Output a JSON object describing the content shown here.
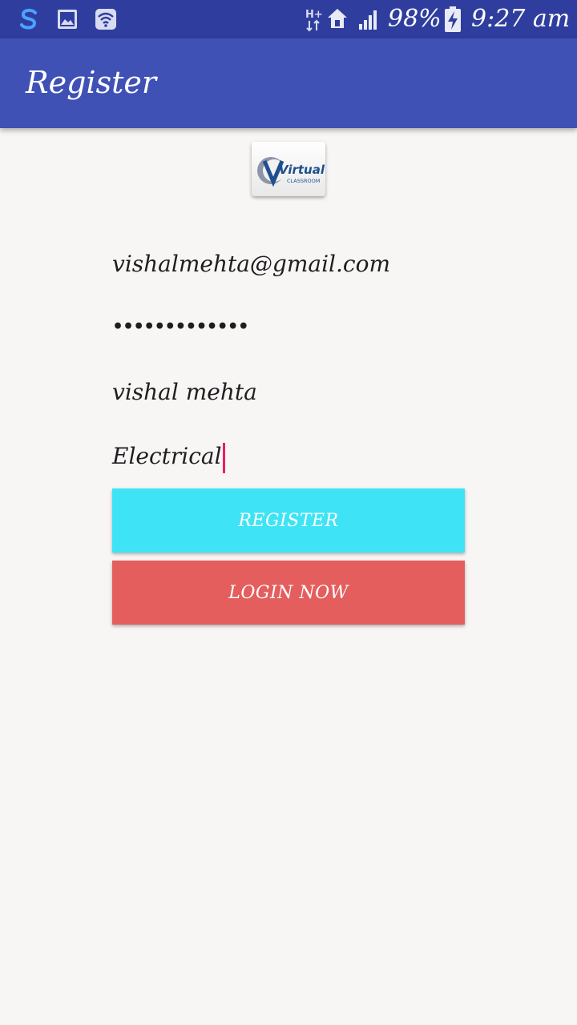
{
  "status_bar": {
    "network_type": "H+",
    "battery": "98%",
    "time": "9:27 am",
    "icons": [
      "s-app-icon",
      "gallery-icon",
      "wifi-icon",
      "network-updown-icon",
      "home-icon",
      "signal-icon",
      "battery-charging-icon"
    ]
  },
  "app_bar": {
    "title": "Register"
  },
  "logo": {
    "name": "Virtual",
    "sub": "CLASSROOM"
  },
  "form": {
    "email": "vishalmehta@gmail.com",
    "password": "•••••••••••••",
    "full_name": "vishal mehta",
    "branch": "Electrical"
  },
  "buttons": {
    "register_label": "REGISTER",
    "login_label": "LOGIN NOW"
  },
  "colors": {
    "status_bar": "#2f3e9e",
    "app_bar": "#3f51b5",
    "background": "#f8f5f5",
    "register_button": "#3ee4f6",
    "login_button": "#e45e5e",
    "cursor": "#e91e63"
  }
}
